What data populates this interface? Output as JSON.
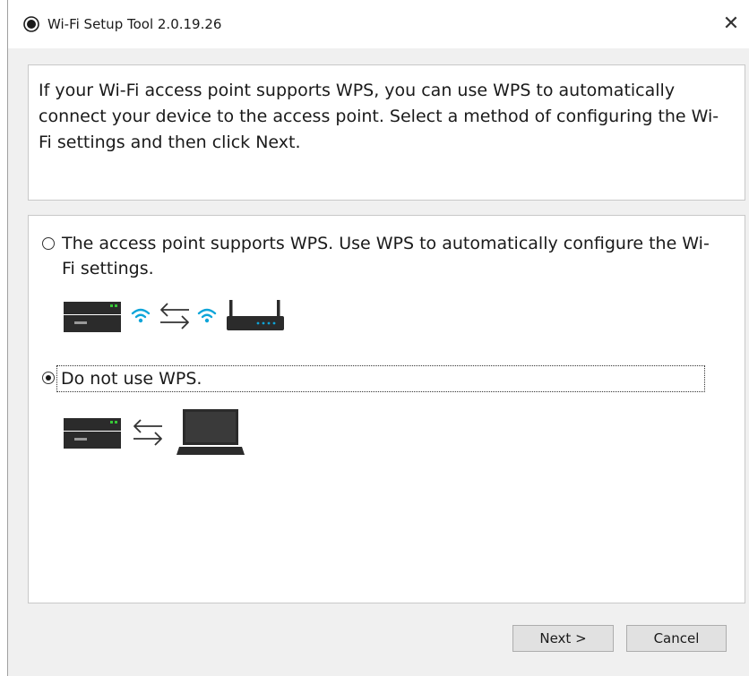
{
  "window": {
    "title": "Wi-Fi Setup Tool 2.0.19.26",
    "close_glyph": "✕"
  },
  "instructions": {
    "text": "If your Wi-Fi access point supports WPS, you can use WPS to automatically connect your device to the access point. Select a method of configuring the Wi-Fi settings and then click Next."
  },
  "options": [
    {
      "label": "The access point supports WPS. Use WPS to automatically configure the Wi-Fi settings.",
      "selected": false,
      "illustration": [
        "printer-icon",
        "wifi-icon",
        "exchange-arrows-icon",
        "wifi-icon",
        "router-icon"
      ]
    },
    {
      "label": "Do not use WPS.",
      "selected": true,
      "illustration": [
        "printer-icon",
        "exchange-arrows-icon",
        "laptop-icon"
      ]
    }
  ],
  "buttons": {
    "next": "Next >",
    "cancel": "Cancel"
  },
  "colors": {
    "wifi": "#0ea5d9",
    "device": "#2b2b2b",
    "printer_light": "#37c837"
  }
}
